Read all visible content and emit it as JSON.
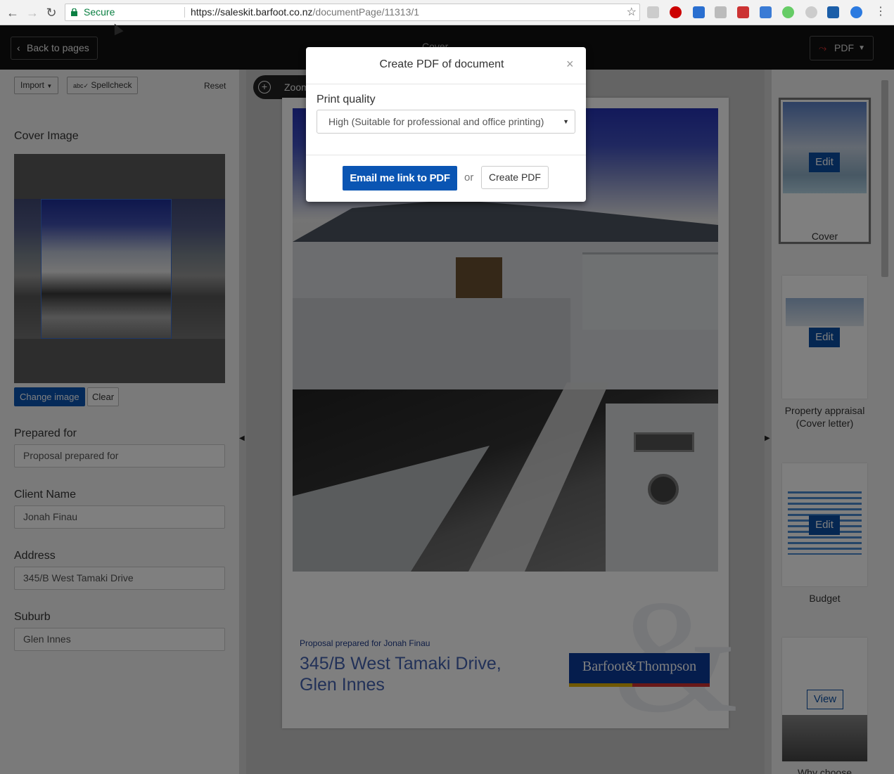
{
  "browser": {
    "secure_label": "Secure",
    "url_host": "https://saleskit.barfoot.co.nz",
    "url_path": "/documentPage/11313/1"
  },
  "topbar": {
    "back_label": "Back to pages",
    "center_title": "Cover",
    "pdf_label": "PDF"
  },
  "left_panel": {
    "import_label": "Import",
    "spellcheck_label": "Spellcheck",
    "reset_label": "Reset",
    "cover_image_label": "Cover Image",
    "change_image_label": "Change image",
    "clear_label": "Clear",
    "fields": [
      {
        "label": "Prepared for",
        "value": "Proposal prepared for"
      },
      {
        "label": "Client Name",
        "value": "Jonah Finau"
      },
      {
        "label": "Address",
        "value": "345/B West Tamaki Drive"
      },
      {
        "label": "Suburb",
        "value": "Glen Innes"
      }
    ]
  },
  "canvas": {
    "zoom_label": "Zoom",
    "doc_subtitle": "Proposal prepared for Jonah Finau",
    "doc_address_line1": "345/B West Tamaki Drive,",
    "doc_address_line2": "Glen Innes",
    "logo_text": "Barfoot&Thompson"
  },
  "pages": [
    {
      "label": "Cover",
      "action": "Edit"
    },
    {
      "label": "Property appraisal (Cover letter)",
      "action": "Edit"
    },
    {
      "label": "Budget",
      "action": "Edit"
    },
    {
      "label": "Why choose",
      "action": "View"
    }
  ],
  "modal": {
    "title": "Create PDF of document",
    "close": "×",
    "print_quality_label": "Print quality",
    "print_quality_value": "High (Suitable for professional and office printing)",
    "email_button": "Email me link to PDF",
    "or_text": "or",
    "create_button": "Create PDF"
  }
}
